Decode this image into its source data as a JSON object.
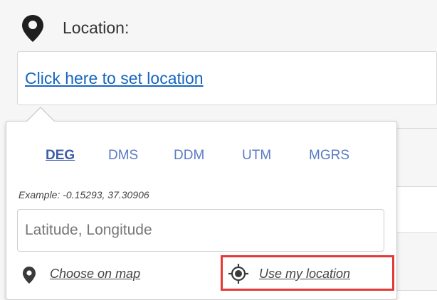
{
  "location": {
    "label": "Location:",
    "link_text": "Click here to set location"
  },
  "popover": {
    "tabs": [
      {
        "label": "DEG",
        "active": true
      },
      {
        "label": "DMS",
        "active": false
      },
      {
        "label": "DDM",
        "active": false
      },
      {
        "label": "UTM",
        "active": false
      },
      {
        "label": "MGRS",
        "active": false
      }
    ],
    "example_text": "Example: -0.15293, 37.30906",
    "input": {
      "placeholder": "Latitude, Longitude",
      "value": ""
    },
    "choose_on_map_label": "Choose on map",
    "use_my_location_label": "Use my location"
  },
  "icons": {
    "location_pin": "map-pin-icon",
    "choose_map_pin": "map-pin-icon",
    "use_location": "crosshair-target-icon"
  },
  "colors": {
    "link": "#1565c0",
    "tab": "#5b7bc4",
    "tab_active": "#3d5fa8",
    "highlight": "#e53935"
  }
}
